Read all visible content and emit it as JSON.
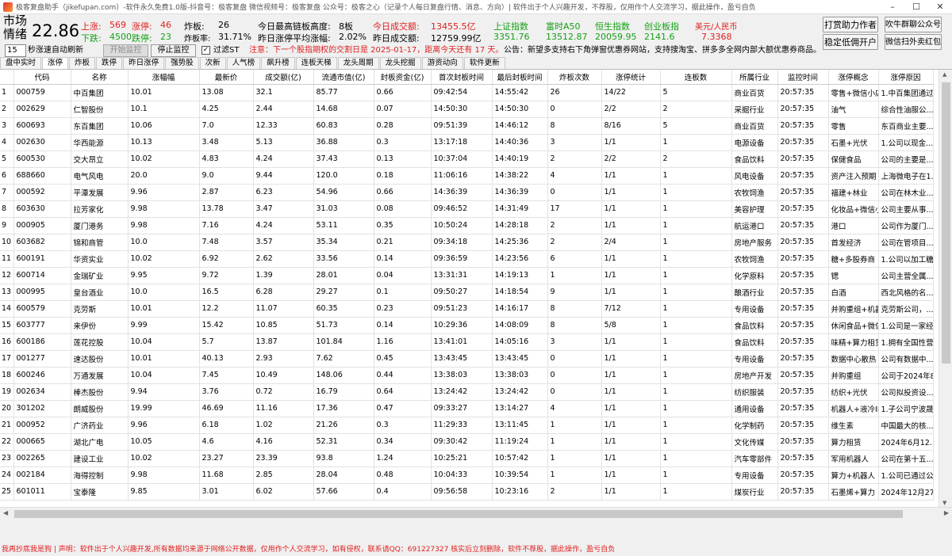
{
  "window": {
    "title": "极客复盘助手（jikefupan.com）-软件永久免费1.0版-抖音号：极客复盘  微信视频号：极客复盘  公众号：极客之心（记录个人每日复盘行情、消息、方向）| 软件出于个人兴趣开发，不荐股，仅用作个人交流学习，据此操作，盈亏自负"
  },
  "market": {
    "label1": "市场",
    "label2": "情绪",
    "score": "22.86",
    "up_label": "上涨:",
    "up_value": "569",
    "limit_up_label": "涨停:",
    "limit_up_value": "46",
    "down_label": "下跌:",
    "down_value": "4500",
    "limit_down_label": "跌停:",
    "limit_down_value": "23",
    "broken_label": "炸板:",
    "broken_value": "26",
    "broken_rate_label": "炸板率:",
    "broken_rate_value": "31.71%",
    "max_chain_label": "今日最高链板高度:",
    "max_chain_value": "8板",
    "avg_gain_label": "昨日涨停平均涨幅:",
    "avg_gain_value": "2.02%",
    "today_vol_label": "今日成交额:",
    "today_vol_value": "13455.5亿",
    "yest_vol_label": "昨日成交额:",
    "yest_vol_value": "12759.99亿"
  },
  "indices": [
    {
      "name": "上证指数",
      "value": "3351.76"
    },
    {
      "name": "富时A50",
      "value": "13512.87"
    },
    {
      "name": "恒生指数",
      "value": "20059.95"
    },
    {
      "name": "创业板指",
      "value": "2141.6"
    },
    {
      "name": "美元/人民币",
      "value": "7.3368"
    }
  ],
  "buttons": {
    "tip_author": "打赏助力作者",
    "wechat_group": "吹牛群聊公众号",
    "open_account": "稳定低佣开户",
    "wechat_redpacket": "微信扫外卖红包",
    "start_monitor": "开始监控",
    "stop_monitor": "停止监控"
  },
  "controls": {
    "refresh_seconds": "15",
    "refresh_label": "秒涨速自动刷新",
    "filter_st_label": "过滤ST",
    "notice": "注意：下一个股指期权的交割日是 2025-01-17，距离今天还有 17 天。",
    "announcement": "公告：新望多支持右下角弹窗优惠券网站，支持搜淘宝、拼多多全网内部大额优惠券商品。"
  },
  "tabs": [
    "盘中实时",
    "涨停",
    "炸板",
    "跌停",
    "昨日涨停",
    "强势股",
    "次新",
    "人气榜",
    "飙升榜",
    "连板天梯",
    "龙头周期",
    "龙头挖掘",
    "游资动向",
    "软件更新"
  ],
  "table": {
    "headers": [
      "",
      "代码",
      "名称",
      "涨幅幅",
      "最新价",
      "成交额(亿)",
      "流通市值(亿)",
      "封板资金(亿)",
      "首次封板时间",
      "最后封板时间",
      "炸板次数",
      "涨停统计",
      "连板数",
      "所属行业",
      "监控时间",
      "涨停概念",
      "涨停原因"
    ],
    "rows": [
      [
        "1",
        "000759",
        "中百集团",
        "10.01",
        "13.08",
        "32.1",
        "85.77",
        "0.66",
        "09:42:54",
        "14:55:42",
        "26",
        "14/22",
        "5",
        "商业百货",
        "20:57:35",
        "零售+微信小店",
        "1.中百集团通过..."
      ],
      [
        "2",
        "002629",
        "仁智股份",
        "10.1",
        "4.25",
        "2.44",
        "14.68",
        "0.07",
        "14:50:30",
        "14:50:30",
        "0",
        "2/2",
        "2",
        "采掘行业",
        "20:57:35",
        "油气",
        "综合性油服公..."
      ],
      [
        "3",
        "600693",
        "东百集团",
        "10.06",
        "7.0",
        "12.33",
        "60.83",
        "0.28",
        "09:51:39",
        "14:46:12",
        "8",
        "8/16",
        "5",
        "商业百货",
        "20:57:35",
        "零售",
        "东百商业主要..."
      ],
      [
        "4",
        "002630",
        "华西能源",
        "10.13",
        "3.48",
        "5.13",
        "36.88",
        "0.3",
        "13:17:18",
        "14:40:36",
        "3",
        "1/1",
        "1",
        "电源设备",
        "20:57:35",
        "石墨+光伏",
        "1.公司以现金..."
      ],
      [
        "5",
        "600530",
        "交大昂立",
        "10.02",
        "4.83",
        "4.24",
        "37.43",
        "0.13",
        "10:37:04",
        "14:40:19",
        "2",
        "2/2",
        "2",
        "食品饮料",
        "20:57:35",
        "保健食品",
        "公司的主要是..."
      ],
      [
        "6",
        "688660",
        "电气风电",
        "20.0",
        "9.0",
        "9.44",
        "120.0",
        "0.18",
        "11:06:16",
        "14:38:22",
        "4",
        "1/1",
        "1",
        "风电设备",
        "20:57:35",
        "资产注入预期",
        "上海微电子在1..."
      ],
      [
        "7",
        "000592",
        "平潭发展",
        "9.96",
        "2.87",
        "6.23",
        "54.96",
        "0.66",
        "14:36:39",
        "14:36:39",
        "0",
        "1/1",
        "1",
        "农牧饲渔",
        "20:57:35",
        "福建+林业",
        "公司在林木业..."
      ],
      [
        "8",
        "603630",
        "拉芳家化",
        "9.98",
        "13.78",
        "3.47",
        "31.03",
        "0.08",
        "09:46:52",
        "14:31:49",
        "17",
        "1/1",
        "1",
        "美容护理",
        "20:57:35",
        "化妆品+微信小店",
        "公司主要从事..."
      ],
      [
        "9",
        "000905",
        "厦门港务",
        "9.98",
        "7.16",
        "4.24",
        "53.11",
        "0.35",
        "10:50:24",
        "14:28:18",
        "2",
        "1/1",
        "1",
        "航运港口",
        "20:57:35",
        "港口",
        "公司作为厦门..."
      ],
      [
        "10",
        "603682",
        "锦和商管",
        "10.0",
        "7.48",
        "3.57",
        "35.34",
        "0.21",
        "09:34:18",
        "14:25:36",
        "2",
        "2/4",
        "1",
        "房地产服务",
        "20:57:35",
        "首发经济",
        "公司在管项目..."
      ],
      [
        "11",
        "600191",
        "华资实业",
        "10.02",
        "6.92",
        "2.62",
        "33.56",
        "0.14",
        "09:36:59",
        "14:23:56",
        "6",
        "1/1",
        "1",
        "农牧饲渔",
        "20:57:35",
        "糖+多股券商",
        "1.公司以加工糖..."
      ],
      [
        "12",
        "600714",
        "金瑞矿业",
        "9.95",
        "9.72",
        "1.39",
        "28.01",
        "0.04",
        "13:31:31",
        "14:19:13",
        "1",
        "1/1",
        "1",
        "化学原料",
        "20:57:35",
        "锶",
        "公司主营全属..."
      ],
      [
        "13",
        "000995",
        "皇台酒业",
        "10.0",
        "16.5",
        "6.28",
        "29.27",
        "0.1",
        "09:50:27",
        "14:18:54",
        "9",
        "1/1",
        "1",
        "酿酒行业",
        "20:57:35",
        "白酒",
        "西北风格的名..."
      ],
      [
        "14",
        "600579",
        "克劳斯",
        "10.01",
        "12.2",
        "11.07",
        "60.35",
        "0.23",
        "09:51:23",
        "14:16:17",
        "8",
        "7/12",
        "1",
        "专用设备",
        "20:57:35",
        "并购重组+机器人",
        "克劳斯公司，..."
      ],
      [
        "15",
        "603777",
        "来伊份",
        "9.99",
        "15.42",
        "10.85",
        "51.73",
        "0.14",
        "10:29:36",
        "14:08:09",
        "8",
        "5/8",
        "1",
        "食品饮料",
        "20:57:35",
        "休闲食品+微信...",
        "1.公司是一家经..."
      ],
      [
        "16",
        "600186",
        "莲花控股",
        "10.04",
        "5.7",
        "13.87",
        "101.84",
        "1.16",
        "13:41:01",
        "14:05:16",
        "3",
        "1/1",
        "1",
        "食品饮料",
        "20:57:35",
        "味精+算力租赁",
        "1.拥有全国性营..."
      ],
      [
        "17",
        "001277",
        "速达股份",
        "10.01",
        "40.13",
        "2.93",
        "7.62",
        "0.45",
        "13:43:45",
        "13:43:45",
        "0",
        "1/1",
        "1",
        "专用设备",
        "20:57:35",
        "数据中心散热",
        "公司有数据中..."
      ],
      [
        "18",
        "600246",
        "万通发展",
        "10.04",
        "7.45",
        "10.49",
        "148.06",
        "0.44",
        "13:38:03",
        "13:38:03",
        "0",
        "1/1",
        "1",
        "房地产开发",
        "20:57:35",
        "并购重组",
        "公司于2024年8..."
      ],
      [
        "19",
        "002634",
        "棒杰股份",
        "9.94",
        "3.76",
        "0.72",
        "16.79",
        "0.64",
        "13:24:42",
        "13:24:42",
        "0",
        "1/1",
        "1",
        "纺织服装",
        "20:57:35",
        "纺织+光伏",
        "公司拟投资设..."
      ],
      [
        "20",
        "301202",
        "朗威股份",
        "19.99",
        "46.69",
        "11.16",
        "17.36",
        "0.47",
        "09:33:27",
        "13:14:27",
        "4",
        "1/1",
        "1",
        "通用设备",
        "20:57:35",
        "机器人+液冷IDC",
        "1.子公司宁波晟..."
      ],
      [
        "21",
        "000952",
        "广济药业",
        "9.96",
        "6.18",
        "1.02",
        "21.26",
        "0.3",
        "11:29:33",
        "13:11:45",
        "1",
        "1/1",
        "1",
        "化学制药",
        "20:57:35",
        "维生素",
        "中国最大的核..."
      ],
      [
        "22",
        "000665",
        "湖北广电",
        "10.05",
        "4.6",
        "4.16",
        "52.31",
        "0.34",
        "09:30:42",
        "11:19:24",
        "1",
        "1/1",
        "1",
        "文化传媒",
        "20:57:35",
        "算力租赁",
        "2024年6月12..."
      ],
      [
        "23",
        "002265",
        "建设工业",
        "10.02",
        "23.27",
        "23.39",
        "93.8",
        "1.24",
        "10:25:21",
        "10:57:42",
        "1",
        "1/1",
        "1",
        "汽车零部件",
        "20:57:35",
        "军用机器人",
        "公司在第十五..."
      ],
      [
        "24",
        "002184",
        "海得控制",
        "9.98",
        "11.68",
        "2.85",
        "28.04",
        "0.48",
        "10:04:33",
        "10:39:54",
        "1",
        "1/1",
        "1",
        "专用设备",
        "20:57:35",
        "算力+机器人",
        "1.公司已通过公..."
      ],
      [
        "25",
        "601011",
        "宝泰隆",
        "9.85",
        "3.01",
        "6.02",
        "57.66",
        "0.4",
        "09:56:58",
        "10:23:16",
        "2",
        "1/1",
        "1",
        "煤炭行业",
        "20:57:35",
        "石墨烯+算力",
        "2024年12月27..."
      ]
    ]
  },
  "footer": "我再抄底我是狗 | 声明：软件出于个人兴趣开发,所有数据均来源于网络公开数据，仅用作个人交流学习，如有侵权，联系请QQ：691227327 核实后立刻删除，软件不荐股，据此操作，盈亏自负",
  "colors": {
    "up": "#e02020",
    "down": "#16a016"
  }
}
